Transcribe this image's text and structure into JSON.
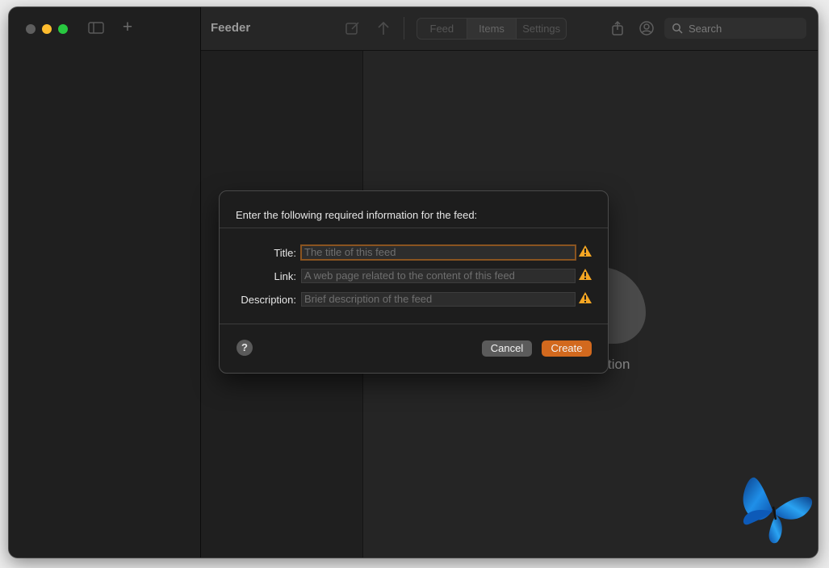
{
  "window": {
    "app_title": "Feeder"
  },
  "toolbar": {
    "segments": [
      {
        "label": "Feed",
        "active": false
      },
      {
        "label": "Items",
        "active": true
      },
      {
        "label": "Settings",
        "active": false
      }
    ],
    "search_placeholder": "Search",
    "icons": [
      "sidebar-toggle-icon",
      "plus-icon",
      "compose-icon",
      "upload-arrow-icon",
      "share-icon",
      "account-icon",
      "search-icon"
    ]
  },
  "background": {
    "partial_text": "tion"
  },
  "dialog": {
    "header": "Enter the following required information for the feed:",
    "fields": [
      {
        "label": "Title:",
        "placeholder": "The title of this feed",
        "value": "",
        "focused": true
      },
      {
        "label": "Link:",
        "placeholder": "A web page related to the content of this feed",
        "value": ""
      },
      {
        "label": "Description:",
        "placeholder": "Brief description of the feed",
        "value": ""
      }
    ],
    "help_label": "?",
    "cancel_label": "Cancel",
    "create_label": "Create"
  },
  "colors": {
    "accent": "#d2691e",
    "warning": "#f5a623",
    "focus_ring": "#8a5420"
  }
}
